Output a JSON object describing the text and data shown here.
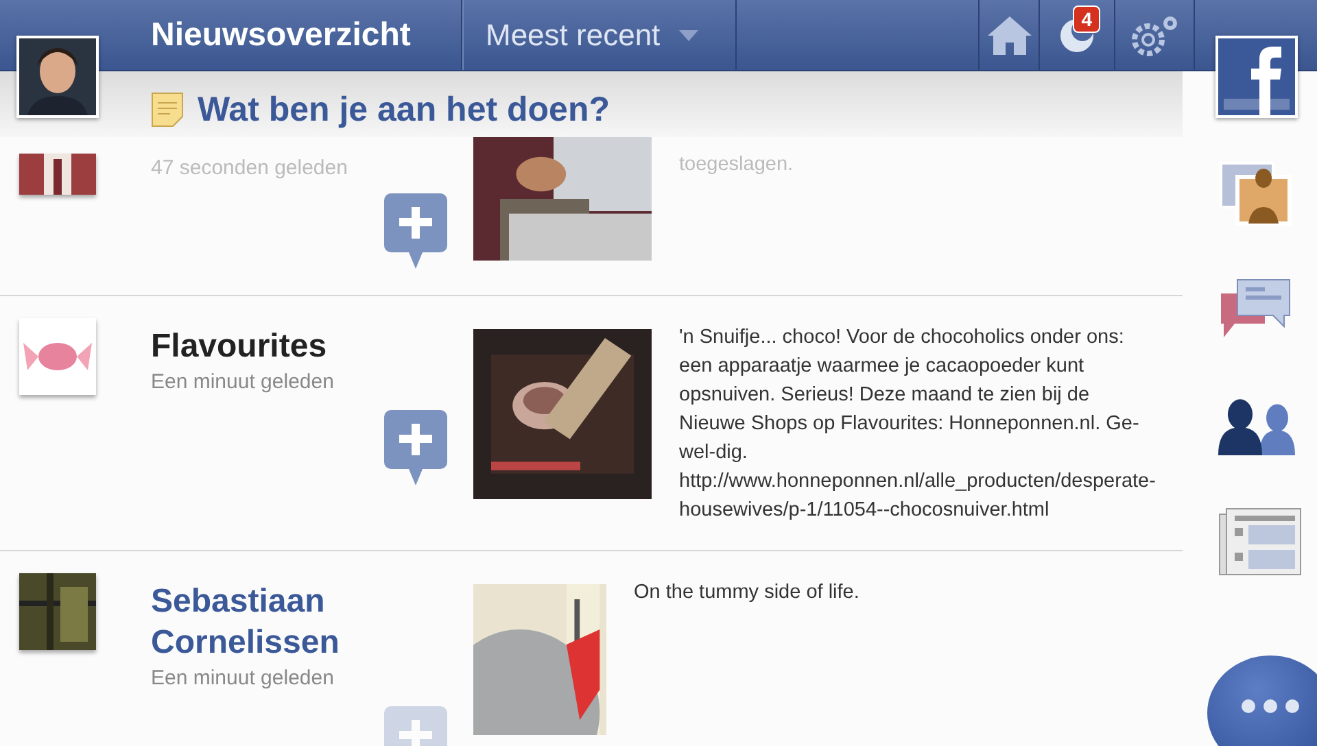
{
  "header": {
    "title": "Nieuwsoverzicht",
    "filter": "Meest recent",
    "notification_count": "4"
  },
  "status_prompt": "Wat ben je aan het doen?",
  "posts": [
    {
      "kind": "partial",
      "time": "47 seconden geleden",
      "text": "toegeslagen."
    },
    {
      "kind": "full",
      "name": "Flavourites",
      "name_link": false,
      "time": "Een minuut geleden",
      "text": "'n Snuifje... choco! Voor de chocoholics onder ons: een apparaatje waarmee je cacaopoeder kunt opsnuiven. Serieus! Deze maand te zien bij de Nieuwe Shops op Flavourites: Honneponnen.nl. Ge-wel-dig. http://www.honneponnen.nl/alle_producten/desperate-housewives/p-1/11054--chocosnuiver.html"
    },
    {
      "kind": "full",
      "name": "Sebastiaan Cornelissen",
      "name_link": true,
      "time": "Een minuut geleden",
      "text": "On the tummy side of life."
    }
  ]
}
